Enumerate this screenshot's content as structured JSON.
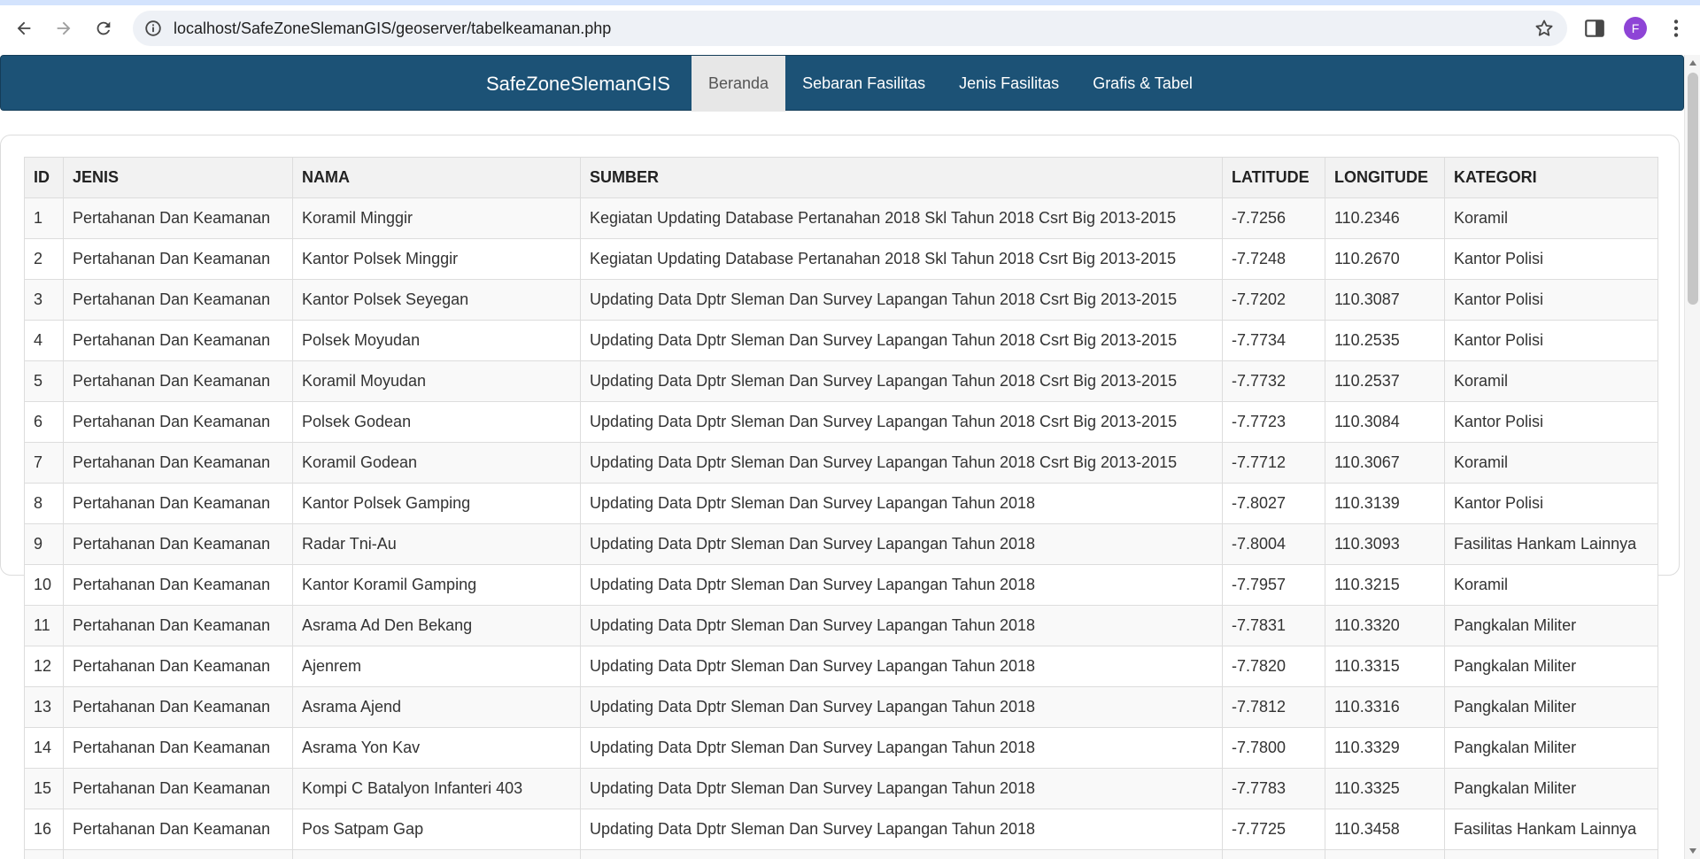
{
  "browser": {
    "url": "localhost/SafeZoneSlemanGIS/geoserver/tabelkeamanan.php",
    "avatar_letter": "F",
    "icons": [
      "back-icon",
      "forward-icon",
      "reload-icon",
      "site-info-icon",
      "bookmark-star-icon",
      "side-panel-icon",
      "menu-kebab-icon"
    ]
  },
  "navbar": {
    "brand": "SafeZoneSlemanGIS",
    "items": [
      {
        "label": "Beranda",
        "active": true
      },
      {
        "label": "Sebaran Fasilitas",
        "active": false
      },
      {
        "label": "Jenis Fasilitas",
        "active": false
      },
      {
        "label": "Grafis & Tabel",
        "active": false
      }
    ],
    "color": "#1c5276"
  },
  "table": {
    "headers": [
      "ID",
      "JENIS",
      "NAMA",
      "SUMBER",
      "LATITUDE",
      "LONGITUDE",
      "KATEGORI"
    ],
    "rows": [
      [
        "1",
        "Pertahanan Dan Keamanan",
        "Koramil Minggir",
        "Kegiatan Updating Database Pertanahan 2018 Skl Tahun 2018 Csrt Big 2013-2015",
        "-7.7256",
        "110.2346",
        "Koramil"
      ],
      [
        "2",
        "Pertahanan Dan Keamanan",
        "Kantor Polsek Minggir",
        "Kegiatan Updating Database Pertanahan 2018 Skl Tahun 2018 Csrt Big 2013-2015",
        "-7.7248",
        "110.2670",
        "Kantor Polisi"
      ],
      [
        "3",
        "Pertahanan Dan Keamanan",
        "Kantor Polsek Seyegan",
        "Updating Data Dptr Sleman Dan Survey Lapangan Tahun 2018 Csrt Big 2013-2015",
        "-7.7202",
        "110.3087",
        "Kantor Polisi"
      ],
      [
        "4",
        "Pertahanan Dan Keamanan",
        "Polsek Moyudan",
        "Updating Data Dptr Sleman Dan Survey Lapangan Tahun 2018 Csrt Big 2013-2015",
        "-7.7734",
        "110.2535",
        "Kantor Polisi"
      ],
      [
        "5",
        "Pertahanan Dan Keamanan",
        "Koramil Moyudan",
        "Updating Data Dptr Sleman Dan Survey Lapangan Tahun 2018 Csrt Big 2013-2015",
        "-7.7732",
        "110.2537",
        "Koramil"
      ],
      [
        "6",
        "Pertahanan Dan Keamanan",
        "Polsek Godean",
        "Updating Data Dptr Sleman Dan Survey Lapangan Tahun 2018 Csrt Big 2013-2015",
        "-7.7723",
        "110.3084",
        "Kantor Polisi"
      ],
      [
        "7",
        "Pertahanan Dan Keamanan",
        "Koramil Godean",
        "Updating Data Dptr Sleman Dan Survey Lapangan Tahun 2018 Csrt Big 2013-2015",
        "-7.7712",
        "110.3067",
        "Koramil"
      ],
      [
        "8",
        "Pertahanan Dan Keamanan",
        "Kantor Polsek Gamping",
        "Updating Data Dptr Sleman Dan Survey Lapangan Tahun 2018",
        "-7.8027",
        "110.3139",
        "Kantor Polisi"
      ],
      [
        "9",
        "Pertahanan Dan Keamanan",
        "Radar Tni-Au",
        "Updating Data Dptr Sleman Dan Survey Lapangan Tahun 2018",
        "-7.8004",
        "110.3093",
        "Fasilitas Hankam Lainnya"
      ],
      [
        "10",
        "Pertahanan Dan Keamanan",
        "Kantor Koramil Gamping",
        "Updating Data Dptr Sleman Dan Survey Lapangan Tahun 2018",
        "-7.7957",
        "110.3215",
        "Koramil"
      ],
      [
        "11",
        "Pertahanan Dan Keamanan",
        "Asrama Ad Den Bekang",
        "Updating Data Dptr Sleman Dan Survey Lapangan Tahun 2018",
        "-7.7831",
        "110.3320",
        "Pangkalan Militer"
      ],
      [
        "12",
        "Pertahanan Dan Keamanan",
        "Ajenrem",
        "Updating Data Dptr Sleman Dan Survey Lapangan Tahun 2018",
        "-7.7820",
        "110.3315",
        "Pangkalan Militer"
      ],
      [
        "13",
        "Pertahanan Dan Keamanan",
        "Asrama Ajend",
        "Updating Data Dptr Sleman Dan Survey Lapangan Tahun 2018",
        "-7.7812",
        "110.3316",
        "Pangkalan Militer"
      ],
      [
        "14",
        "Pertahanan Dan Keamanan",
        "Asrama Yon Kav",
        "Updating Data Dptr Sleman Dan Survey Lapangan Tahun 2018",
        "-7.7800",
        "110.3329",
        "Pangkalan Militer"
      ],
      [
        "15",
        "Pertahanan Dan Keamanan",
        "Kompi C Batalyon Infanteri 403",
        "Updating Data Dptr Sleman Dan Survey Lapangan Tahun 2018",
        "-7.7783",
        "110.3325",
        "Pangkalan Militer"
      ],
      [
        "16",
        "Pertahanan Dan Keamanan",
        "Pos Satpam Gap",
        "Updating Data Dptr Sleman Dan Survey Lapangan Tahun 2018",
        "-7.7725",
        "110.3458",
        "Fasilitas Hankam Lainnya"
      ],
      [
        "",
        "",
        "",
        "",
        "",
        "",
        ""
      ]
    ]
  }
}
